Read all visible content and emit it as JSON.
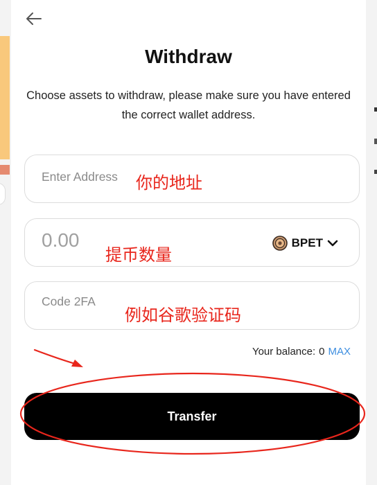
{
  "title": "Withdraw",
  "subtitle": "Choose assets to withdraw, please make sure you have entered the correct wallet address.",
  "address": {
    "placeholder": "Enter Address",
    "value": ""
  },
  "amount": {
    "placeholder": "0.00",
    "value": ""
  },
  "token": {
    "symbol": "BPET",
    "icon": "coin-icon"
  },
  "code": {
    "placeholder": "Code 2FA",
    "value": ""
  },
  "balance": {
    "label": "Your balance:",
    "value": "0",
    "max_label": "MAX"
  },
  "transfer_label": "Transfer",
  "annotations": {
    "address": "你的地址",
    "amount": "提币数量",
    "code": "例如谷歌验证码"
  },
  "colors": {
    "accent": "#3d8ee0",
    "annotation": "#e8261c",
    "button_bg": "#000000"
  }
}
